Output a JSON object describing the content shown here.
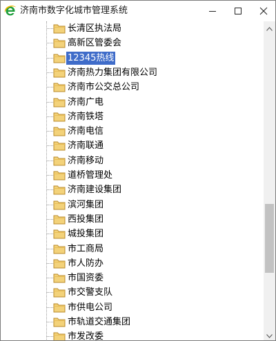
{
  "window": {
    "title": "济南市数字化城市管理系统",
    "accent": "#3f6cc9"
  },
  "tree": {
    "items": [
      {
        "label": "长清区执法局",
        "selected": false
      },
      {
        "label": "高新区管委会",
        "selected": false
      },
      {
        "label": "12345热线",
        "selected": true
      },
      {
        "label": "济南热力集团有限公司",
        "selected": false
      },
      {
        "label": "济南市公交总公司",
        "selected": false
      },
      {
        "label": "济南广电",
        "selected": false
      },
      {
        "label": "济南铁塔",
        "selected": false
      },
      {
        "label": "济南电信",
        "selected": false
      },
      {
        "label": "济南联通",
        "selected": false
      },
      {
        "label": "济南移动",
        "selected": false
      },
      {
        "label": "道桥管理处",
        "selected": false
      },
      {
        "label": "济南建设集团",
        "selected": false
      },
      {
        "label": "滨河集团",
        "selected": false
      },
      {
        "label": "西投集团",
        "selected": false
      },
      {
        "label": "城投集团",
        "selected": false
      },
      {
        "label": "市工商局",
        "selected": false
      },
      {
        "label": "市人防办",
        "selected": false
      },
      {
        "label": "市国资委",
        "selected": false
      },
      {
        "label": "市交警支队",
        "selected": false
      },
      {
        "label": "市供电公司",
        "selected": false
      },
      {
        "label": "市轨道交通集团",
        "selected": false
      },
      {
        "label": "市发改委",
        "selected": false
      }
    ]
  },
  "icons": {
    "app": "ie-logo-icon",
    "folder": "folder-icon",
    "minimize": "minimize-icon",
    "maximize": "maximize-icon",
    "close": "close-icon"
  }
}
